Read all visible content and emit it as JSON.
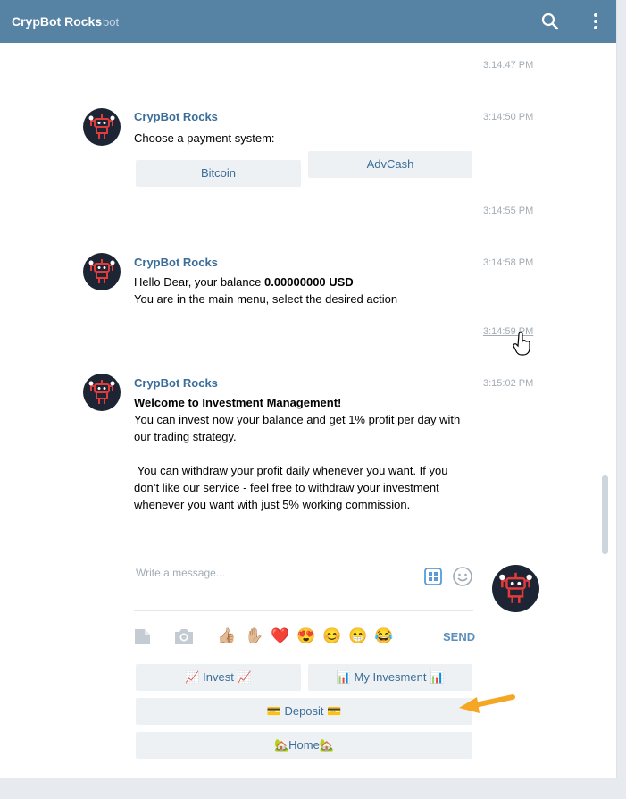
{
  "header": {
    "title": "CrypBot Rocks",
    "subtitle": "bot"
  },
  "messages": {
    "t0": "3:14:47 PM",
    "m1": {
      "author": "CrypBot Rocks",
      "time": "3:14:50 PM",
      "text": "Choose a payment system:",
      "buttons": [
        "Bitcoin",
        "AdvCash"
      ]
    },
    "t1": "3:14:55 PM",
    "m2": {
      "author": "CrypBot Rocks",
      "time": "3:14:58 PM",
      "line1_prefix": "Hello Dear, your balance ",
      "balance": "0.00000000 USD",
      "line2": "You are in the main menu, select the desired action"
    },
    "t2": "3:14:59 PM",
    "m3": {
      "author": "CrypBot Rocks",
      "time": "3:15:02 PM",
      "heading": "Welcome to Investment Management!",
      "p1": "You can invest now your balance and get 1% profit per day with our trading strategy.",
      "p2": " You can withdraw your profit daily whenever you want. If you don’t like our service - feel free to withdraw your investment whenever you want with just 5% working commission."
    }
  },
  "composer": {
    "placeholder": "Write a message...",
    "send_label": "SEND",
    "emojis": [
      "👍🏼",
      "✋🏼",
      "❤️",
      "😍",
      "😊",
      "😁",
      "😂"
    ]
  },
  "keyboard": {
    "invest": "📈 Invest 📈",
    "my_investment": "📊 My Invesment 📊",
    "deposit": "💳 Deposit 💳",
    "home": "🏡Home🏡"
  },
  "colors": {
    "header_bg": "#5682a3",
    "accent": "#3a6d99",
    "button_bg": "#eef1f4",
    "arrow": "#f5a623"
  },
  "icons": [
    "search-icon",
    "more-vertical-icon",
    "robot-avatar-icon",
    "sticker-panel-icon",
    "emoji-smile-icon",
    "file-icon",
    "camera-icon",
    "pointer-cursor-icon",
    "arrow-annotation-icon"
  ]
}
